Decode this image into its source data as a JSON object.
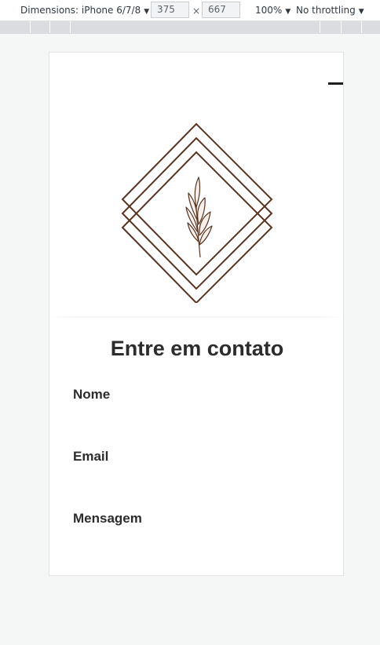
{
  "devtools": {
    "dimensions_label": "Dimensions: iPhone 6/7/8",
    "width": "375",
    "height": "667",
    "times": "×",
    "zoom": "100%",
    "throttling": "No throttling",
    "caret": "▼",
    "more": "⋮"
  },
  "page": {
    "title": "Entre em contato",
    "form": {
      "name_label": "Nome",
      "email_label": "Email",
      "message_label": "Mensagem"
    }
  },
  "colors": {
    "logo_stroke": "#5a3320",
    "text": "#2c2c2c",
    "page_bg": "#f5f6f6"
  }
}
